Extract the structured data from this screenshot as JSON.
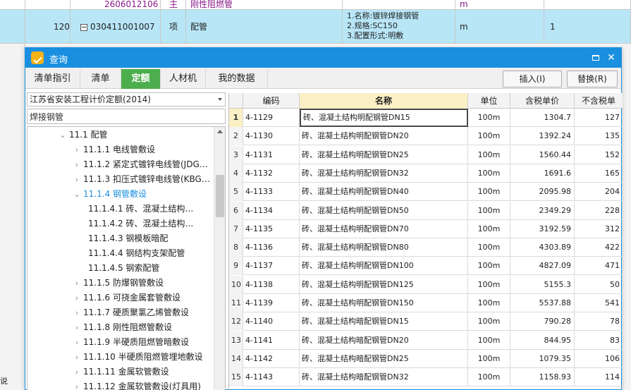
{
  "background": {
    "row1": {
      "code": "2606012106",
      "type": "主",
      "name": "刚性阻燃管",
      "unit": "m"
    },
    "row2": {
      "index": "120",
      "code": "030411001007",
      "type": "项",
      "name": "配管",
      "desc_lines": [
        "1.名称:镀锌焊接钢管",
        "2.规格:SC150",
        "3.配置形式:明敷"
      ],
      "unit": "m",
      "qty": "1"
    },
    "left_text": "说"
  },
  "dialog": {
    "title": "查询",
    "tabs": [
      "清单指引",
      "清单",
      "定额",
      "人材机",
      "我的数据"
    ],
    "active_tab": "定额",
    "insert_label": "插入(I)",
    "replace_label": "替换(R)",
    "library_select": "江苏省安装工程计价定额(2014)",
    "search_value": "焊接钢管"
  },
  "tree": [
    {
      "label": "11.1 配管",
      "toggle": "open"
    },
    {
      "label": "11.1.1 电线管敷设",
      "toggle": "closed"
    },
    {
      "label": "11.1.2 紧定式镀锌电线管(JDG…",
      "toggle": "closed"
    },
    {
      "label": "11.1.3 扣压式镀锌电线管(KBG…",
      "toggle": "closed"
    },
    {
      "label": "11.1.4 钢管敷设",
      "toggle": "open",
      "selected": true
    },
    {
      "label": "11.1.4.1 砖、混凝土结构…",
      "toggle": "none"
    },
    {
      "label": "11.1.4.2 砖、混凝土结构…",
      "toggle": "none"
    },
    {
      "label": "11.1.4.3 钢模板暗配",
      "toggle": "none"
    },
    {
      "label": "11.1.4.4 钢结构支架配管",
      "toggle": "none"
    },
    {
      "label": "11.1.4.5 钢索配管",
      "toggle": "none"
    },
    {
      "label": "11.1.5 防爆钢管敷设",
      "toggle": "closed"
    },
    {
      "label": "11.1.6 可挠金属套管敷设",
      "toggle": "closed"
    },
    {
      "label": "11.1.7 硬质聚氯乙烯管敷设",
      "toggle": "closed"
    },
    {
      "label": "11.1.8 刚性阻燃管敷设",
      "toggle": "closed"
    },
    {
      "label": "11.1.9 半硬质阻燃管暗敷设",
      "toggle": "closed"
    },
    {
      "label": "11.1.10 半硬质阻燃管埋地敷设",
      "toggle": "closed"
    },
    {
      "label": "11.1.11 金属软管敷设",
      "toggle": "closed"
    },
    {
      "label": "11.1.12 金属软管敷设(灯具用)",
      "toggle": "closed"
    }
  ],
  "grid": {
    "columns": [
      "编码",
      "名称",
      "单位",
      "含税单价",
      "不含税单"
    ],
    "rows": [
      {
        "n": "1",
        "code": "4-1129",
        "name": "砖、混凝土结构明配钢管DN15",
        "unit": "100m",
        "price_tax": "1304.7",
        "price_notax": "127"
      },
      {
        "n": "2",
        "code": "4-1130",
        "name": "砖、混凝土结构明配钢管DN20",
        "unit": "100m",
        "price_tax": "1392.24",
        "price_notax": "135"
      },
      {
        "n": "3",
        "code": "4-1131",
        "name": "砖、混凝土结构明配钢管DN25",
        "unit": "100m",
        "price_tax": "1560.44",
        "price_notax": "152"
      },
      {
        "n": "4",
        "code": "4-1132",
        "name": "砖、混凝土结构明配钢管DN32",
        "unit": "100m",
        "price_tax": "1691.6",
        "price_notax": "165"
      },
      {
        "n": "5",
        "code": "4-1133",
        "name": "砖、混凝土结构明配钢管DN40",
        "unit": "100m",
        "price_tax": "2095.98",
        "price_notax": "204"
      },
      {
        "n": "6",
        "code": "4-1134",
        "name": "砖、混凝土结构明配钢管DN50",
        "unit": "100m",
        "price_tax": "2349.29",
        "price_notax": "228"
      },
      {
        "n": "7",
        "code": "4-1135",
        "name": "砖、混凝土结构明配钢管DN70",
        "unit": "100m",
        "price_tax": "3192.59",
        "price_notax": "312"
      },
      {
        "n": "8",
        "code": "4-1136",
        "name": "砖、混凝土结构明配钢管DN80",
        "unit": "100m",
        "price_tax": "4303.89",
        "price_notax": "422"
      },
      {
        "n": "9",
        "code": "4-1137",
        "name": "砖、混凝土结构明配钢管DN100",
        "unit": "100m",
        "price_tax": "4827.09",
        "price_notax": "471"
      },
      {
        "n": "10",
        "code": "4-1138",
        "name": "砖、混凝土结构明配钢管DN125",
        "unit": "100m",
        "price_tax": "5155.3",
        "price_notax": "50"
      },
      {
        "n": "11",
        "code": "4-1139",
        "name": "砖、混凝土结构明配钢管DN150",
        "unit": "100m",
        "price_tax": "5537.88",
        "price_notax": "541"
      },
      {
        "n": "12",
        "code": "4-1140",
        "name": "砖、混凝土结构暗配钢管DN15",
        "unit": "100m",
        "price_tax": "790.28",
        "price_notax": "78"
      },
      {
        "n": "13",
        "code": "4-1141",
        "name": "砖、混凝土结构暗配钢管DN20",
        "unit": "100m",
        "price_tax": "844.95",
        "price_notax": "83"
      },
      {
        "n": "14",
        "code": "4-1142",
        "name": "砖、混凝土结构暗配钢管DN25",
        "unit": "100m",
        "price_tax": "1079.35",
        "price_notax": "106"
      },
      {
        "n": "15",
        "code": "4-1143",
        "name": "砖、混凝土结构暗配钢管DN32",
        "unit": "100m",
        "price_tax": "1158.93",
        "price_notax": "114"
      }
    ]
  },
  "colors": {
    "titlebar": "#1a8fe0",
    "active_tab": "#4cae4c",
    "selected_row_bg": "#b8e6f7",
    "sorted_header": "#fbf0c5",
    "tree_selected": "#1a8fe0"
  }
}
